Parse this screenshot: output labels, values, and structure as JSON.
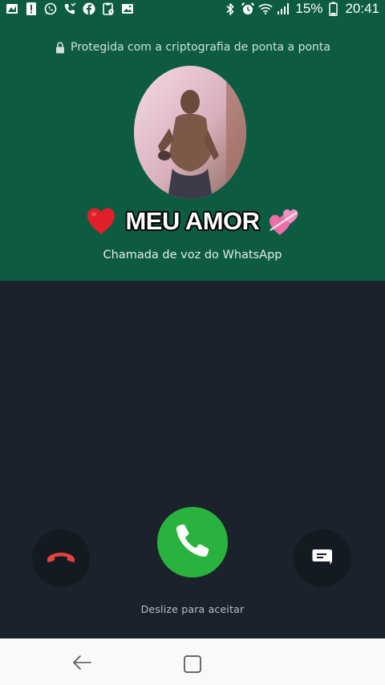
{
  "status_bar": {
    "notification_icons": [
      "image-icon",
      "alert-icon",
      "whatsapp-icon",
      "missed-call-icon",
      "facebook-icon",
      "clipboard-icon",
      "gallery-icon"
    ],
    "system_icons": [
      "bluetooth-icon",
      "alarm-icon",
      "wifi-icon",
      "signal-icon"
    ],
    "battery_percent": "15%",
    "time": "20:41"
  },
  "call": {
    "encryption_notice": "Protegida com a criptografia de ponta a ponta",
    "caller_name": "MEU AMOR",
    "caller_emoji_left": "heart-icon",
    "caller_emoji_right": "two-hearts-icon",
    "call_type": "Chamada de voz do WhatsApp",
    "slide_hint": "Deslize para aceitar"
  },
  "colors": {
    "header_green": "#0d5c42",
    "background_dark": "#1c222b",
    "accept_green": "#29b33e",
    "decline_red": "#e5443c"
  },
  "nav_bar": {
    "buttons": [
      "back-icon",
      "home-icon"
    ]
  }
}
